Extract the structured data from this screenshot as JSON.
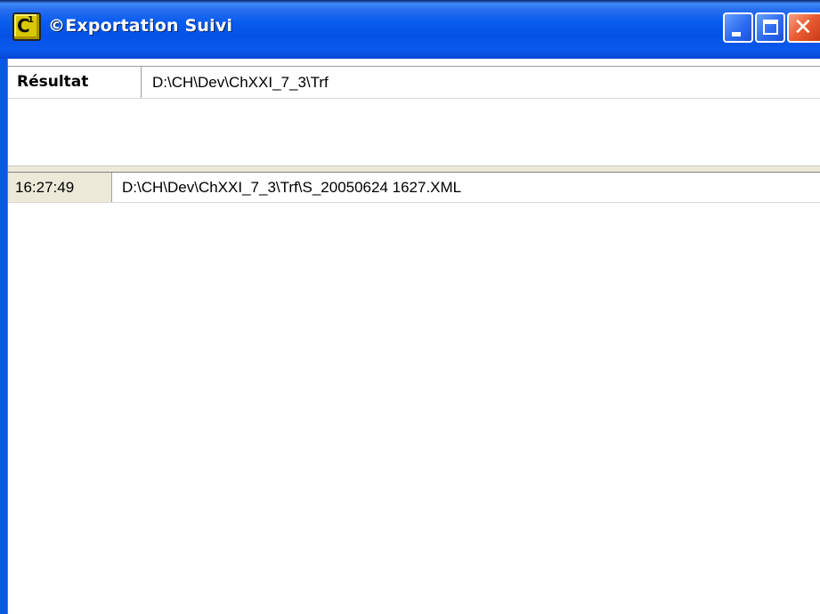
{
  "window": {
    "title": "©Exportation Suivi",
    "icon": "app-icon",
    "buttons": {
      "minimize": "minimize-icon",
      "maximize": "maximize-icon",
      "close": "close-icon"
    },
    "colors": {
      "titlebar": "#0a58e4",
      "close_button": "#e85a30",
      "panel_bg": "#ece9d8"
    }
  },
  "result": {
    "label": "Résultat",
    "value": "D:\\CH\\Dev\\ChXXI_7_3\\Trf"
  },
  "log": {
    "rows": [
      {
        "time": "16:27:49",
        "file": "D:\\CH\\Dev\\ChXXI_7_3\\Trf\\S_20050624 1627.XML"
      }
    ]
  }
}
